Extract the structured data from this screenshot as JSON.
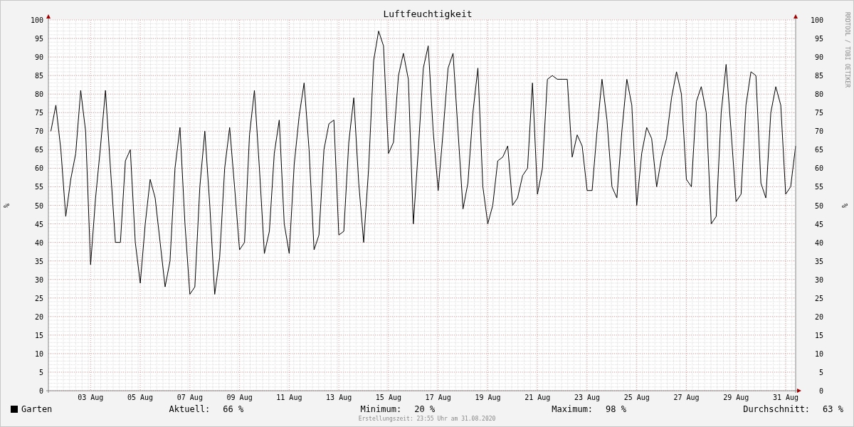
{
  "chart": {
    "chart_data": {
      "type": "line",
      "grid": true,
      "title": "Luftfeuchtigkeit",
      "ylabel": "%",
      "ylim": [
        0,
        100
      ],
      "categories": [
        null,
        null,
        null,
        null,
        null,
        null,
        null,
        null,
        "03 Aug",
        null,
        null,
        null,
        null,
        null,
        null,
        null,
        null,
        null,
        "05 Aug",
        null,
        null,
        null,
        null,
        null,
        null,
        null,
        null,
        null,
        "07 Aug",
        null,
        null,
        null,
        null,
        null,
        null,
        null,
        null,
        null,
        "09 Aug",
        null,
        null,
        null,
        null,
        null,
        null,
        null,
        null,
        null,
        "11 Aug",
        null,
        null,
        null,
        null,
        null,
        null,
        null,
        null,
        null,
        "13 Aug",
        null,
        null,
        null,
        null,
        null,
        null,
        null,
        null,
        null,
        "15 Aug",
        null,
        null,
        null,
        null,
        null,
        null,
        null,
        null,
        null,
        "17 Aug",
        null,
        null,
        null,
        null,
        null,
        null,
        null,
        null,
        null,
        "19 Aug",
        null,
        null,
        null,
        null,
        null,
        null,
        null,
        null,
        null,
        "21 Aug",
        null,
        null,
        null,
        null,
        null,
        null,
        null,
        null,
        null,
        "23 Aug",
        null,
        null,
        null,
        null,
        null,
        null,
        null,
        null,
        null,
        "25 Aug",
        null,
        null,
        null,
        null,
        null,
        null,
        null,
        null,
        null,
        "27 Aug",
        null,
        null,
        null,
        null,
        null,
        null,
        null,
        null,
        null,
        "29 Aug",
        null,
        null,
        null,
        null,
        null,
        null,
        null,
        null,
        null,
        "31 Aug",
        null,
        null
      ],
      "y2lim": [
        0,
        100
      ],
      "y2ticks": [
        0,
        5,
        10,
        15,
        20,
        25,
        30,
        35,
        40,
        45,
        50,
        55,
        60,
        65,
        70,
        75,
        80,
        85,
        90,
        95,
        100
      ],
      "yticks": [
        0,
        5,
        10,
        15,
        20,
        25,
        30,
        35,
        40,
        45,
        50,
        55,
        60,
        65,
        70,
        75,
        80,
        85,
        90,
        95,
        100
      ],
      "series": [
        {
          "name": "Garten",
          "color": "#000000",
          "values": [
            70,
            77,
            65,
            47,
            57,
            64,
            81,
            70,
            34,
            52,
            66,
            81,
            60,
            40,
            40,
            62,
            65,
            40,
            29,
            45,
            57,
            52,
            40,
            28,
            35,
            60,
            71,
            45,
            26,
            28,
            55,
            70,
            50,
            26,
            36,
            60,
            71,
            55,
            38,
            40,
            69,
            81,
            60,
            37,
            43,
            64,
            73,
            45,
            37,
            61,
            74,
            83,
            65,
            38,
            42,
            65,
            72,
            73,
            42,
            43,
            67,
            79,
            56,
            40,
            60,
            89,
            97,
            93,
            64,
            67,
            85,
            91,
            84,
            45,
            65,
            87,
            93,
            70,
            54,
            70,
            87,
            91,
            70,
            49,
            56,
            75,
            87,
            55,
            45,
            50,
            62,
            63,
            66,
            50,
            52,
            58,
            60,
            83,
            53,
            60,
            84,
            85,
            84,
            84,
            84,
            63,
            69,
            66,
            54,
            54,
            70,
            84,
            73,
            55,
            52,
            70,
            84,
            77,
            50,
            64,
            71,
            68,
            55,
            63,
            68,
            79,
            86,
            80,
            57,
            55,
            78,
            82,
            75,
            45,
            47,
            75,
            88,
            70,
            51,
            53,
            77,
            86,
            85,
            56,
            52,
            75,
            82,
            77,
            53,
            55,
            66
          ]
        }
      ]
    }
  },
  "credit": "RRDTOOL / TOBI OETIKER",
  "legend": {
    "stats": [
      {
        "label": "Aktuell:",
        "value": "66 %"
      },
      {
        "label": "Minimum:",
        "value": "20 %"
      },
      {
        "label": "Maximum:",
        "value": "98 %"
      },
      {
        "label": "Durchschnitt:",
        "value": "63 %"
      }
    ]
  },
  "footer": "Erstellungszeit: 23:55 Uhr am 31.08.2020"
}
